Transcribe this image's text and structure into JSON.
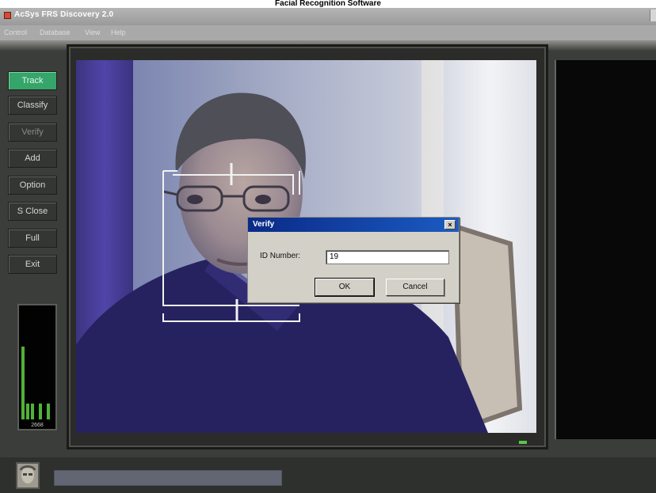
{
  "caption": "Facial Recognition Software",
  "window": {
    "title": "AcSys FRS Discovery 2.0"
  },
  "menu": [
    "Control",
    "Database",
    "View",
    "Help"
  ],
  "sidebar": [
    {
      "label": "Track",
      "state": "active"
    },
    {
      "label": "Classify",
      "state": "normal"
    },
    {
      "label": "Verify",
      "state": "disabled"
    },
    {
      "label": "Add",
      "state": "normal"
    },
    {
      "label": "Option",
      "state": "normal"
    },
    {
      "label": "S Close",
      "state": "normal"
    },
    {
      "label": "Full",
      "state": "normal"
    },
    {
      "label": "Exit",
      "state": "normal"
    }
  ],
  "meter": {
    "count": "2668",
    "level_color": "#4fb337"
  },
  "dialog": {
    "title": "Verify",
    "close_glyph": "×",
    "id_label": "ID Number:",
    "id_value": "19",
    "ok": "OK",
    "cancel": "Cancel"
  },
  "colors": {
    "accent": "#35a56a",
    "dialog_title": "#0a2a87"
  }
}
